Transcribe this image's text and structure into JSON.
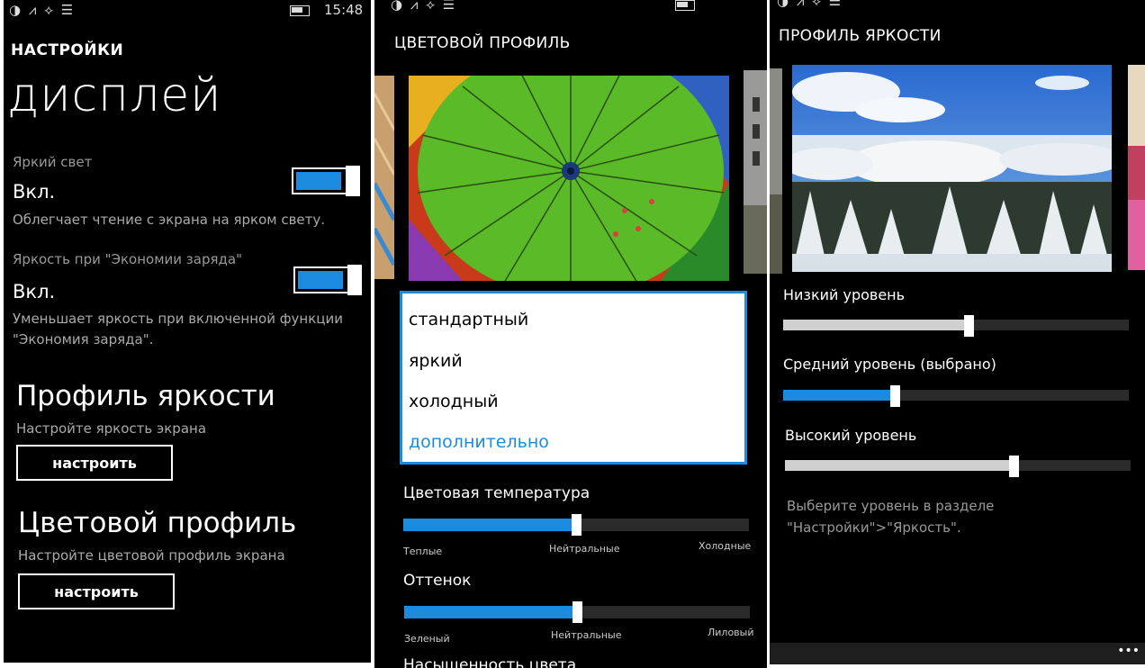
{
  "status": {
    "icons": "◑ ⩘ ⟡ ☰",
    "time": "15:48"
  },
  "display_screen": {
    "header": "НАСТРОЙКИ",
    "title": "дисплей",
    "bright_light": {
      "label": "Яркий свет",
      "value": "Вкл.",
      "desc": "Облегчает чтение с экрана на ярком свету.",
      "on": true
    },
    "battery_saver": {
      "label": "Яркость при \"Экономии заряда\"",
      "value": "Вкл.",
      "desc1": "Уменьшает яркость при включенной функции",
      "desc2": "\"Экономия заряда\".",
      "on": true
    },
    "brightness_profile": {
      "title": "Профиль яркости",
      "desc": "Настройте яркость экрана",
      "button": "настроить"
    },
    "color_profile": {
      "title": "Цветовой профиль",
      "desc": "Настройте цветовой профиль экрана",
      "button": "настроить"
    }
  },
  "color_screen": {
    "header": "ЦВЕТОВОЙ ПРОФИЛЬ",
    "options": [
      "стандартный",
      "яркий",
      "холодный",
      "дополнительно"
    ],
    "selected_option": "дополнительно",
    "temperature": {
      "label": "Цветовая температура",
      "value_pct": 50,
      "ticks": [
        "Теплые",
        "Нейтральные",
        "Холодные"
      ]
    },
    "tint": {
      "label": "Оттенок",
      "value_pct": 50,
      "ticks": [
        "Зеленый",
        "Нейтральные",
        "Лиловый"
      ]
    },
    "cut_label": "Насыщенность цвета"
  },
  "brightness_screen": {
    "header": "ПРОФИЛЬ ЯРКОСТИ",
    "low": {
      "label": "Низкий уровень",
      "value_pct": 53
    },
    "medium": {
      "label": "Средний уровень (выбрано)",
      "value_pct": 32
    },
    "high": {
      "label": "Высокий уровень",
      "value_pct": 66
    },
    "note1": "Выберите уровень в разделе",
    "note2": "\"Настройки\">\"Яркость\".",
    "more": "•••"
  },
  "colors": {
    "accent": "#1b8be0",
    "background": "#000000",
    "foreground": "#ffffff"
  }
}
